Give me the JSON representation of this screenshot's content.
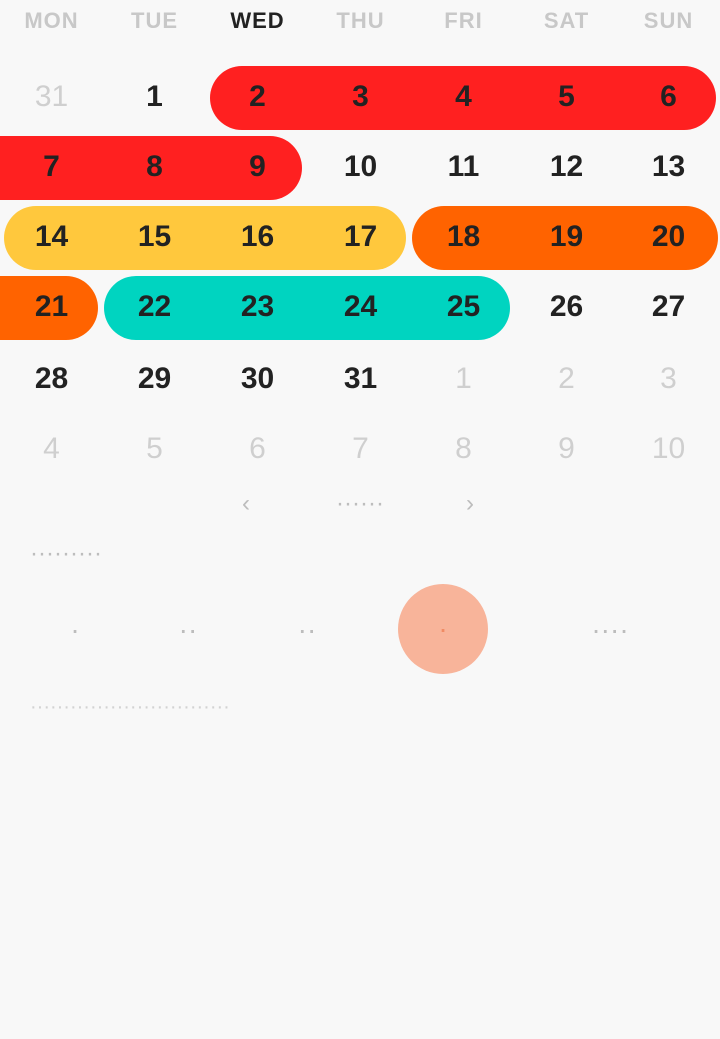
{
  "weekdays": [
    "MON",
    "TUE",
    "WED",
    "THU",
    "FRI",
    "SAT",
    "SUN"
  ],
  "colors": {
    "red": "#ff2020",
    "yellow": "#ffc83d",
    "orange": "#ff6300",
    "teal": "#00d4c0",
    "weekday_text": "#c8c8c8",
    "weekday_bold": "#222222",
    "selected_circle": "#f8b49a"
  },
  "calendar": {
    "rows": [
      [
        "31",
        "1",
        "2",
        "3",
        "4",
        "5",
        "6"
      ],
      [
        "7",
        "8",
        "9",
        "10",
        "11",
        "12",
        "13"
      ],
      [
        "14",
        "15",
        "16",
        "17",
        "18",
        "19",
        "20"
      ],
      [
        "21",
        "22",
        "23",
        "24",
        "25",
        "26",
        "27"
      ],
      [
        "28",
        "29",
        "30",
        "31",
        "1",
        "2",
        "3"
      ],
      [
        "4",
        "5",
        "6",
        "7",
        "8",
        "9",
        "10"
      ]
    ]
  },
  "nav": {
    "prev": "‹",
    "label": "······",
    "next": "›"
  },
  "section_label": "·········",
  "options": [
    "·",
    "··",
    "··",
    "·",
    "····"
  ],
  "hint": "······························"
}
